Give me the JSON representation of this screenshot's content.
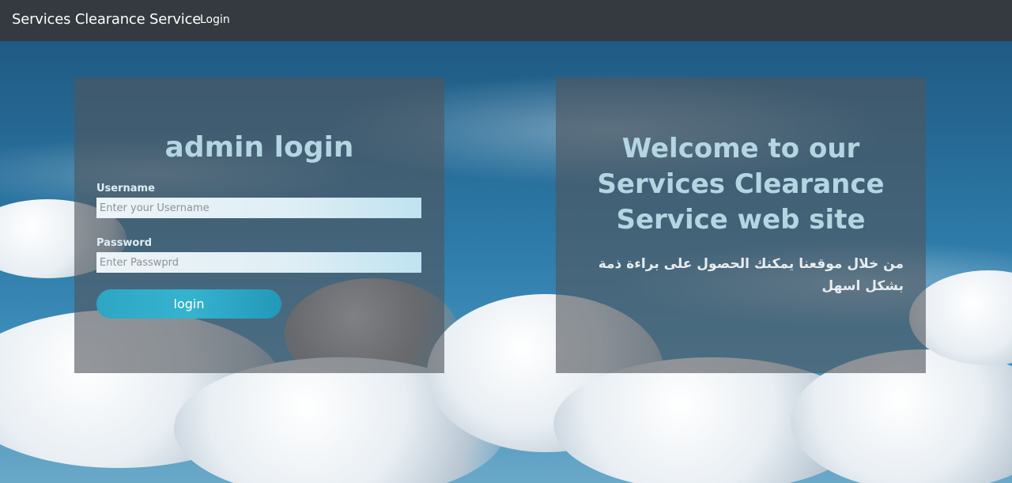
{
  "navbar": {
    "brand": "Services Clearance Service",
    "links": [
      {
        "label": "Login"
      }
    ]
  },
  "login_panel": {
    "title": "admin login",
    "username": {
      "label": "Username",
      "placeholder": "Enter your Username",
      "value": ""
    },
    "password": {
      "label": "Password",
      "placeholder": "Enter Passwprd",
      "value": ""
    },
    "submit_label": "login"
  },
  "welcome_panel": {
    "heading": "Welcome to our Services Clearance Service web site",
    "subtitle": "من خلال موقعنا يمكنك الحصول على براءة ذمة بشكل اسهل"
  },
  "colors": {
    "navbar": "#343a40",
    "panel_overlay": "#50565c",
    "heading_text": "#b3d6e2",
    "button": "#2ea6c4"
  }
}
